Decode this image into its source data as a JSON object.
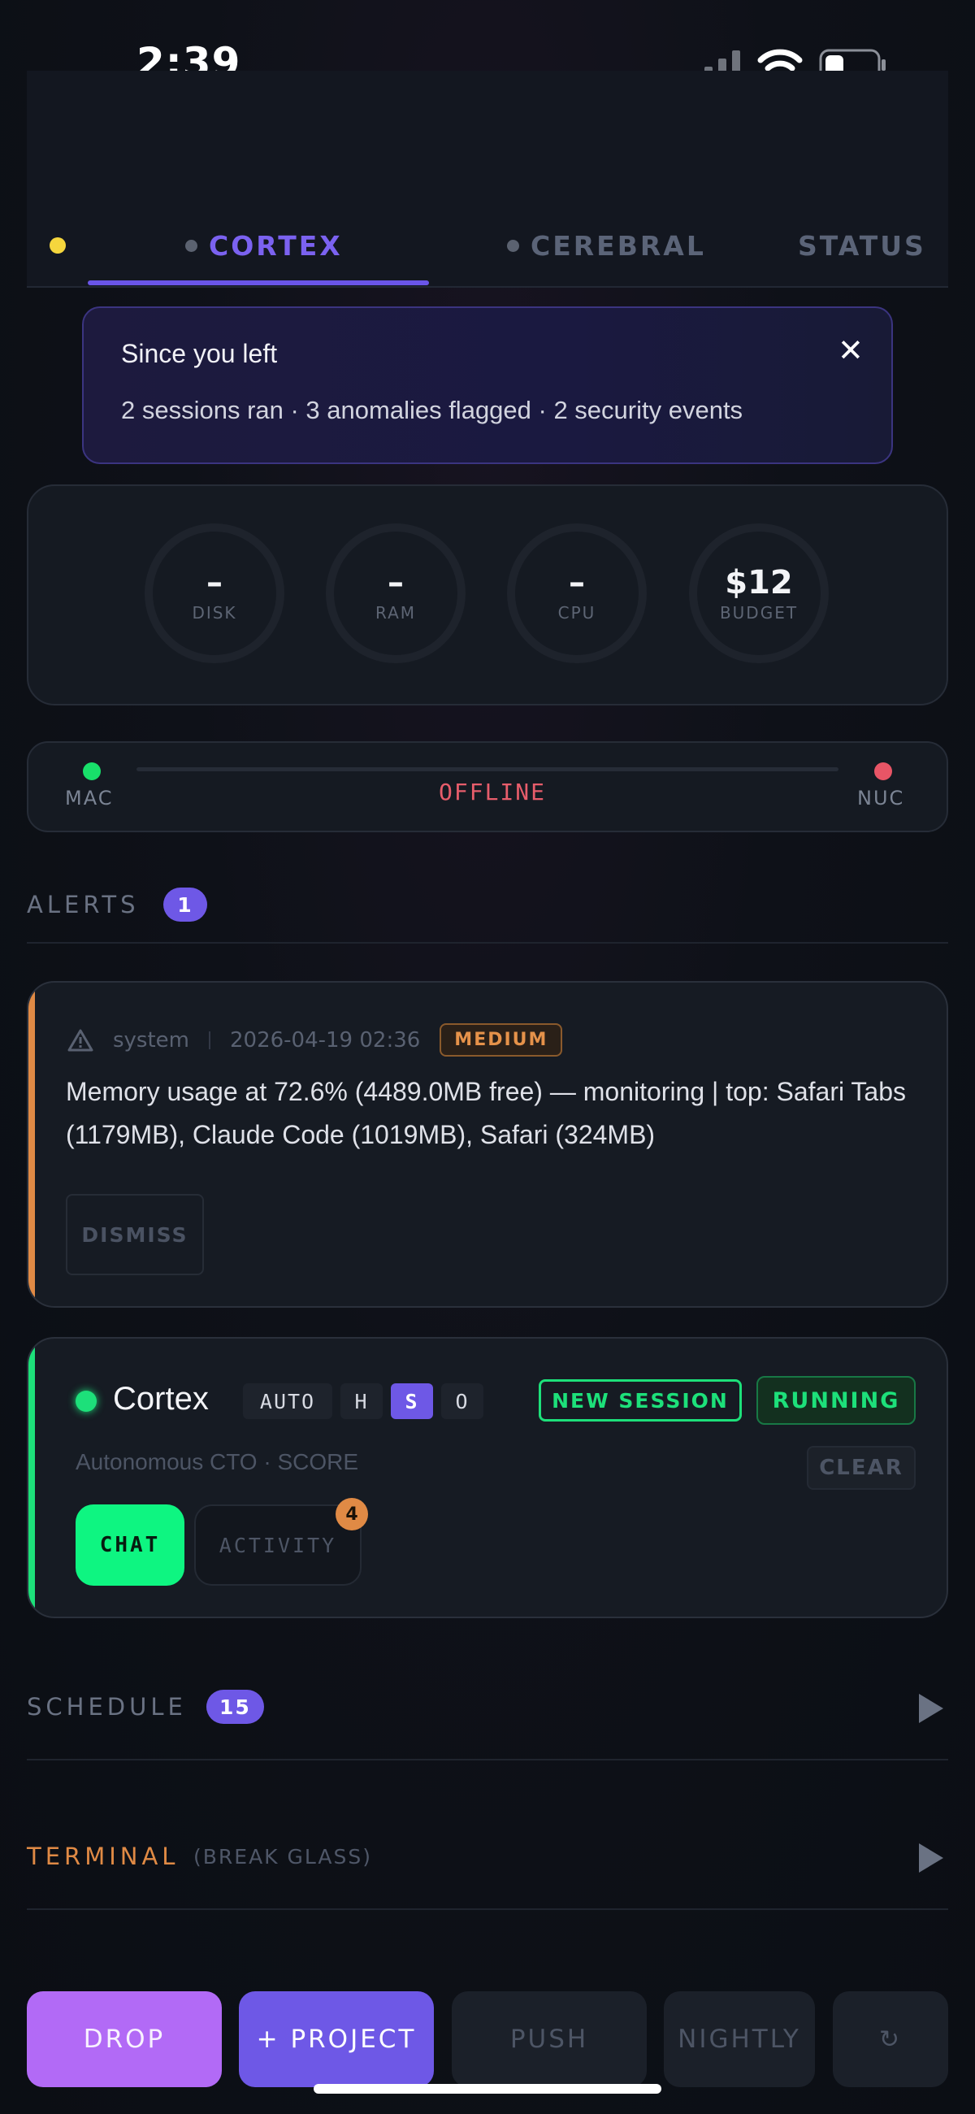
{
  "status_bar": {
    "time": "2:39"
  },
  "tabs": [
    {
      "label": "CORTEX",
      "active": true
    },
    {
      "label": "CEREBRAL",
      "active": false
    },
    {
      "label": "STATUS",
      "active": false
    }
  ],
  "since_banner": {
    "title": "Since you left",
    "body": "2 sessions ran · 3 anomalies flagged · 2 security events",
    "close": "✕"
  },
  "gauges": [
    {
      "value": "–",
      "label": "DISK"
    },
    {
      "value": "–",
      "label": "RAM"
    },
    {
      "value": "–",
      "label": "CPU"
    },
    {
      "value": "$12",
      "label": "BUDGET"
    }
  ],
  "connection": {
    "left_label": "MAC",
    "right_label": "NUC",
    "status": "OFFLINE",
    "left_color": "#18e06a",
    "right_color": "#e85566"
  },
  "alerts": {
    "label": "ALERTS",
    "count": "1",
    "items": [
      {
        "source": "system",
        "timestamp": "2026-04-19 02:36",
        "severity": "MEDIUM",
        "message": "Memory usage at 72.6% (4489.0MB free) — monitoring | top: Safari Tabs (1179MB), Claude Code (1019MB), Safari (324MB)",
        "dismiss_label": "DISMISS",
        "accent": "#e08a45"
      }
    ]
  },
  "session": {
    "name": "Cortex",
    "modes": [
      "AUTO",
      "H",
      "S",
      "O"
    ],
    "active_mode": "S",
    "new_session_label": "NEW SESSION",
    "state": "RUNNING",
    "subtitle": "Autonomous CTO · SCORE",
    "clear_label": "CLEAR",
    "chat_label": "CHAT",
    "activity_label": "ACTIVITY",
    "activity_count": "4",
    "accent": "#1de07a"
  },
  "schedule": {
    "label": "SCHEDULE",
    "count": "15"
  },
  "terminal": {
    "label": "TERMINAL",
    "sublabel": "(BREAK GLASS)"
  },
  "bottom_buttons": {
    "drop": "DROP",
    "project": "+ PROJECT",
    "push": "PUSH",
    "nightly": "NIGHTLY",
    "refresh": "↻"
  }
}
